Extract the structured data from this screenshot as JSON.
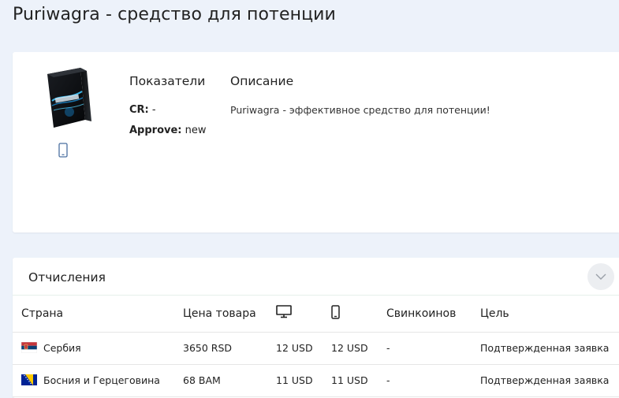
{
  "page": {
    "title": "Puriwagra - средство для потенции"
  },
  "offer": {
    "devices": [
      "mobile-icon"
    ],
    "stats_heading": "Показатели",
    "description_heading": "Описание",
    "cr_label": "CR:",
    "cr_value": " -",
    "approve_label": "Approve:",
    "approve_value": " new",
    "description": "Puriwagra - эффективное средство для потенции!"
  },
  "payouts": {
    "title": "Отчисления",
    "columns": {
      "country": "Страна",
      "price": "Цена товара",
      "desktop_icon": "desktop-icon",
      "mobile_icon": "mobile-icon",
      "swincoins": "Свинкоинов",
      "goal": "Цель"
    },
    "rows": [
      {
        "flag": "serbia-flag-icon",
        "country": "Сербия",
        "price": "3650 RSD",
        "desktop": "12 USD",
        "mobile": "12 USD",
        "swincoins": "-",
        "goal": "Подтвержденная заявка"
      },
      {
        "flag": "bosnia-flag-icon",
        "country": "Босния и Герцеговина",
        "price": "68 BAM",
        "desktop": "11 USD",
        "mobile": "11 USD",
        "swincoins": "-",
        "goal": "Подтвержденная заявка"
      }
    ]
  },
  "colors": {
    "background": "#edf2fa",
    "card": "#ffffff",
    "device_icon": "#4a6fa0"
  }
}
